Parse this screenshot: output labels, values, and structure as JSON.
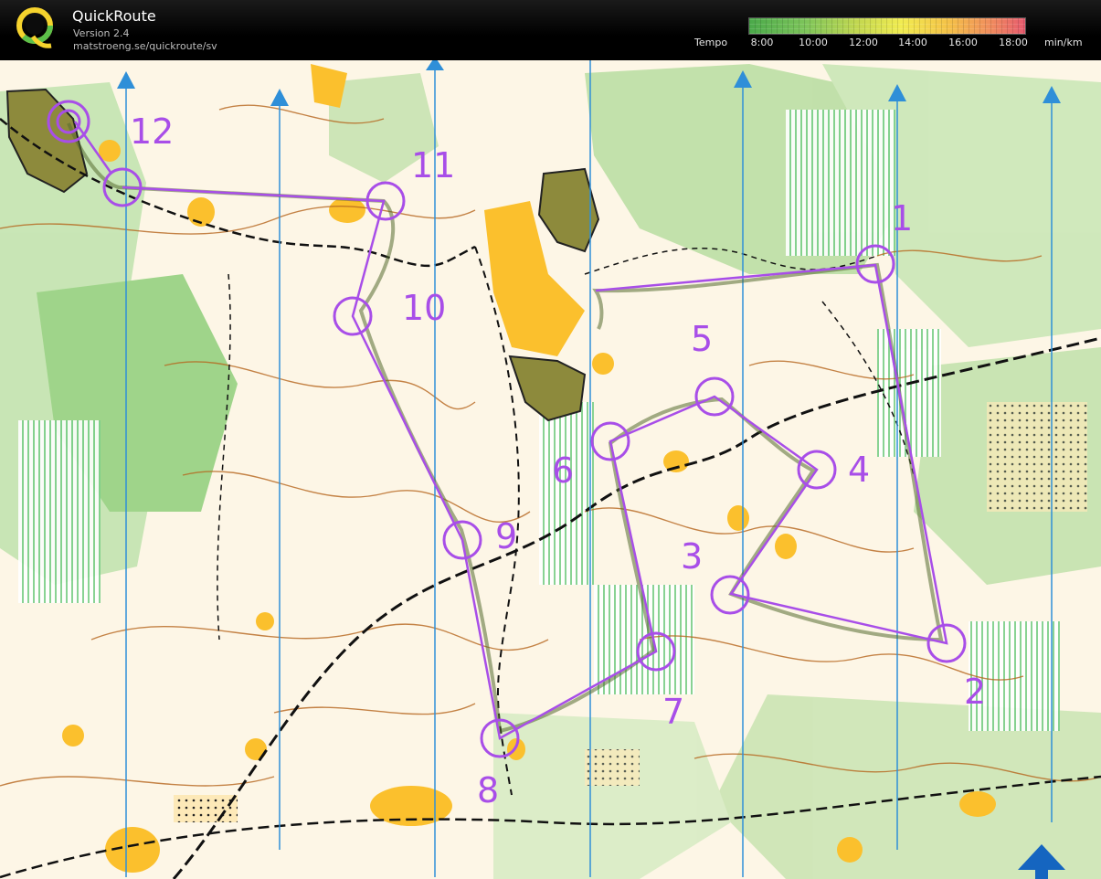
{
  "header": {
    "title": "QuickRoute",
    "version": "Version 2.4",
    "url": "matstroeng.se/quickroute/sv"
  },
  "tempo": {
    "label": "Tempo",
    "ticks": [
      "8:00",
      "10:00",
      "12:00",
      "14:00",
      "16:00",
      "18:00"
    ],
    "unit": "min/km"
  },
  "course": {
    "control_labels": [
      "1",
      "2",
      "3",
      "4",
      "5",
      "6",
      "7",
      "8",
      "9",
      "10",
      "11",
      "12"
    ],
    "route_color": "#a84ee8"
  },
  "colors": {
    "header_bg": "#000000",
    "forest_green": "#9fd48a",
    "open_yellow": "#fbc02d",
    "contour_brown": "#b5651d",
    "north_line_blue": "#2f8fd8",
    "course_purple": "#a84ee8"
  }
}
